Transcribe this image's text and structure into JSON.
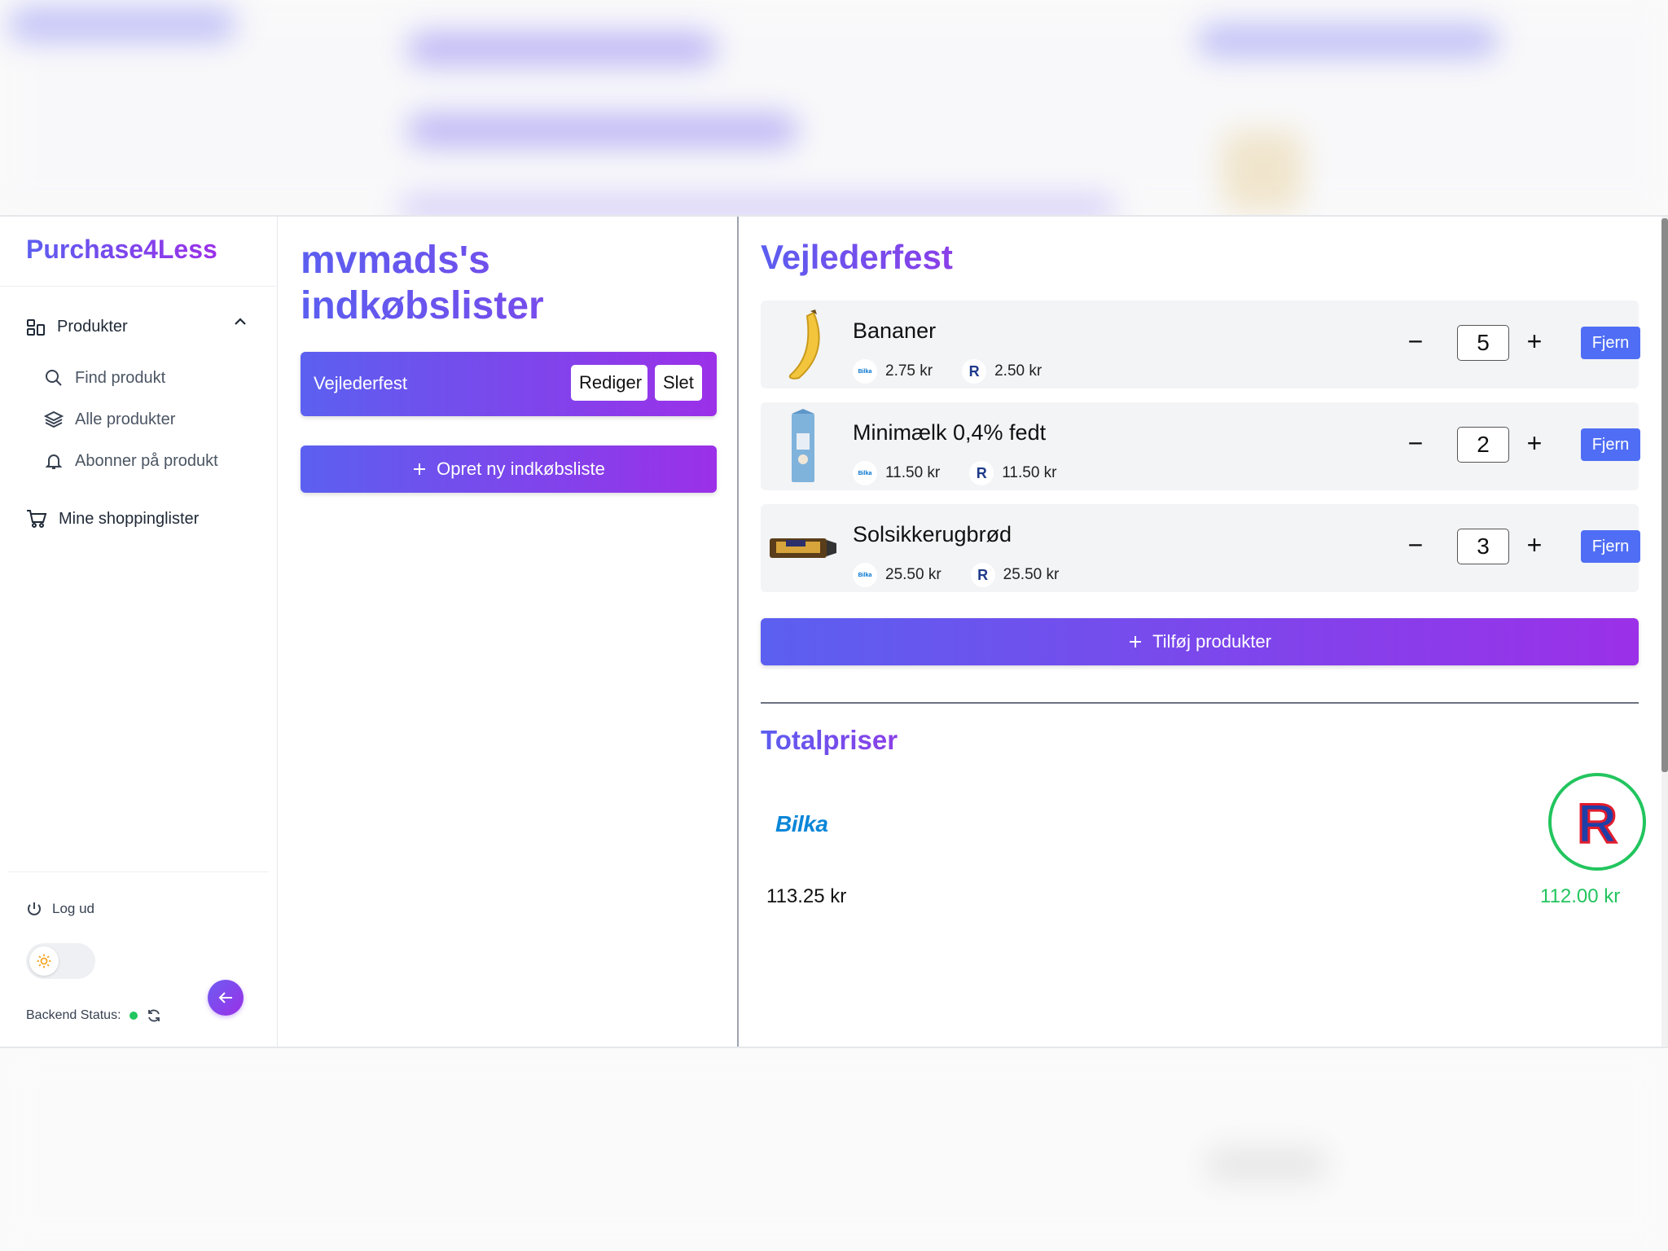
{
  "sidebar": {
    "brand": "Purchase4Less",
    "products_label": "Produkter",
    "find_product": "Find produkt",
    "all_products": "Alle produkter",
    "subscribe_product": "Abonner på produkt",
    "my_lists": "Mine shoppinglister",
    "logout": "Log ud",
    "backend_status_label": "Backend Status:"
  },
  "lists_panel": {
    "title": "mvmads's indkøbslister",
    "lists": [
      {
        "name": "Vejlederfest",
        "edit_label": "Rediger",
        "delete_label": "Slet"
      }
    ],
    "create_label": "Opret ny indkøbsliste"
  },
  "detail": {
    "title": "Vejlederfest",
    "stores": {
      "bilka": "Bilka",
      "rema": "R"
    },
    "items": [
      {
        "name": "Bananer",
        "bilka_price": "2.75 kr",
        "rema_price": "2.50 kr",
        "quantity": "5",
        "remove_label": "Fjern",
        "image": "banana-image"
      },
      {
        "name": "Minimælk 0,4% fedt",
        "bilka_price": "11.50 kr",
        "rema_price": "11.50 kr",
        "quantity": "2",
        "remove_label": "Fjern",
        "image": "milk-carton-image"
      },
      {
        "name": "Solsikkerugbrød",
        "bilka_price": "25.50 kr",
        "rema_price": "25.50 kr",
        "quantity": "3",
        "remove_label": "Fjern",
        "image": "rye-bread-image"
      }
    ],
    "qty_minus": "−",
    "qty_plus": "+",
    "add_products_label": "Tilføj produkter",
    "totals_title": "Totalpriser",
    "bilka_total": "113.25 kr",
    "rema_total": "112.00 kr"
  },
  "colors": {
    "accent_start": "#5b60f0",
    "accent_end": "#9b30e8",
    "remove_button": "#4f6ef5",
    "best_price": "#22c55e",
    "bilka_blue": "#0a86d8"
  }
}
